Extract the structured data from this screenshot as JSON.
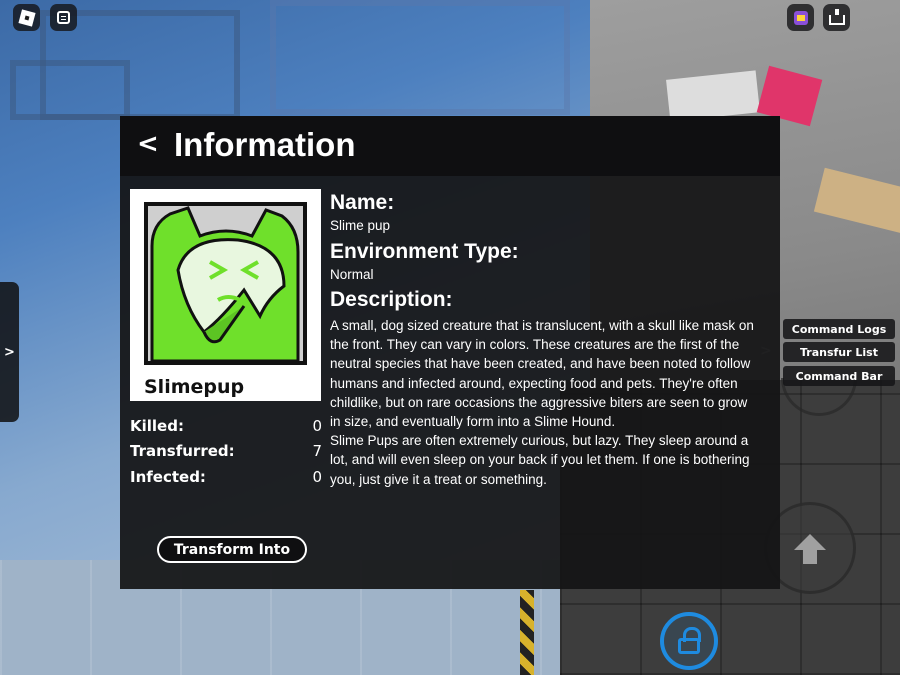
{
  "panel": {
    "back_label": "<",
    "title": "Information",
    "portrait_name": "Slimepup",
    "name_heading": "Name:",
    "name_value": "Slime pup",
    "env_heading": "Environment Type:",
    "env_value": "Normal",
    "desc_heading": "Description:",
    "desc_paragraphs": [
      "A small, dog sized creature that is translucent, with a skull like mask on the front. They can vary in colors. These creatures are the first of the neutral species that have been created, and have been noted to follow humans and infected around, expecting food and pets. They're often childlike, but on rare occasions the aggressive biters are seen to grow in size, and eventually form into a Slime Hound.",
      "Slime Pups are often extremely curious, but lazy. They sleep around a lot, and will even sleep on your back if you let them. If one is bothering you, just give it a treat or something."
    ],
    "stats": [
      {
        "label": "Killed:",
        "value": "0"
      },
      {
        "label": "Transfurred:",
        "value": "7"
      },
      {
        "label": "Infected:",
        "value": "0"
      }
    ],
    "transform_label": "Transform Into"
  },
  "side_tab": {
    "label": ">"
  },
  "command_menu": {
    "arrow": ">",
    "items": [
      "Command Logs",
      "Transfur List",
      "Command Bar"
    ]
  },
  "icons": {
    "top_left": [
      "roblox-menu-icon",
      "chat-icon"
    ],
    "top_right": [
      "avatar-icon",
      "emote-icon"
    ],
    "bottom": [
      "jump-icon",
      "shift-lock-icon"
    ]
  },
  "colors": {
    "panel_bg": "#141416",
    "header_bg": "#0f0f11",
    "slime_green": "#6fe02b",
    "lock_blue": "#1e8be0"
  }
}
